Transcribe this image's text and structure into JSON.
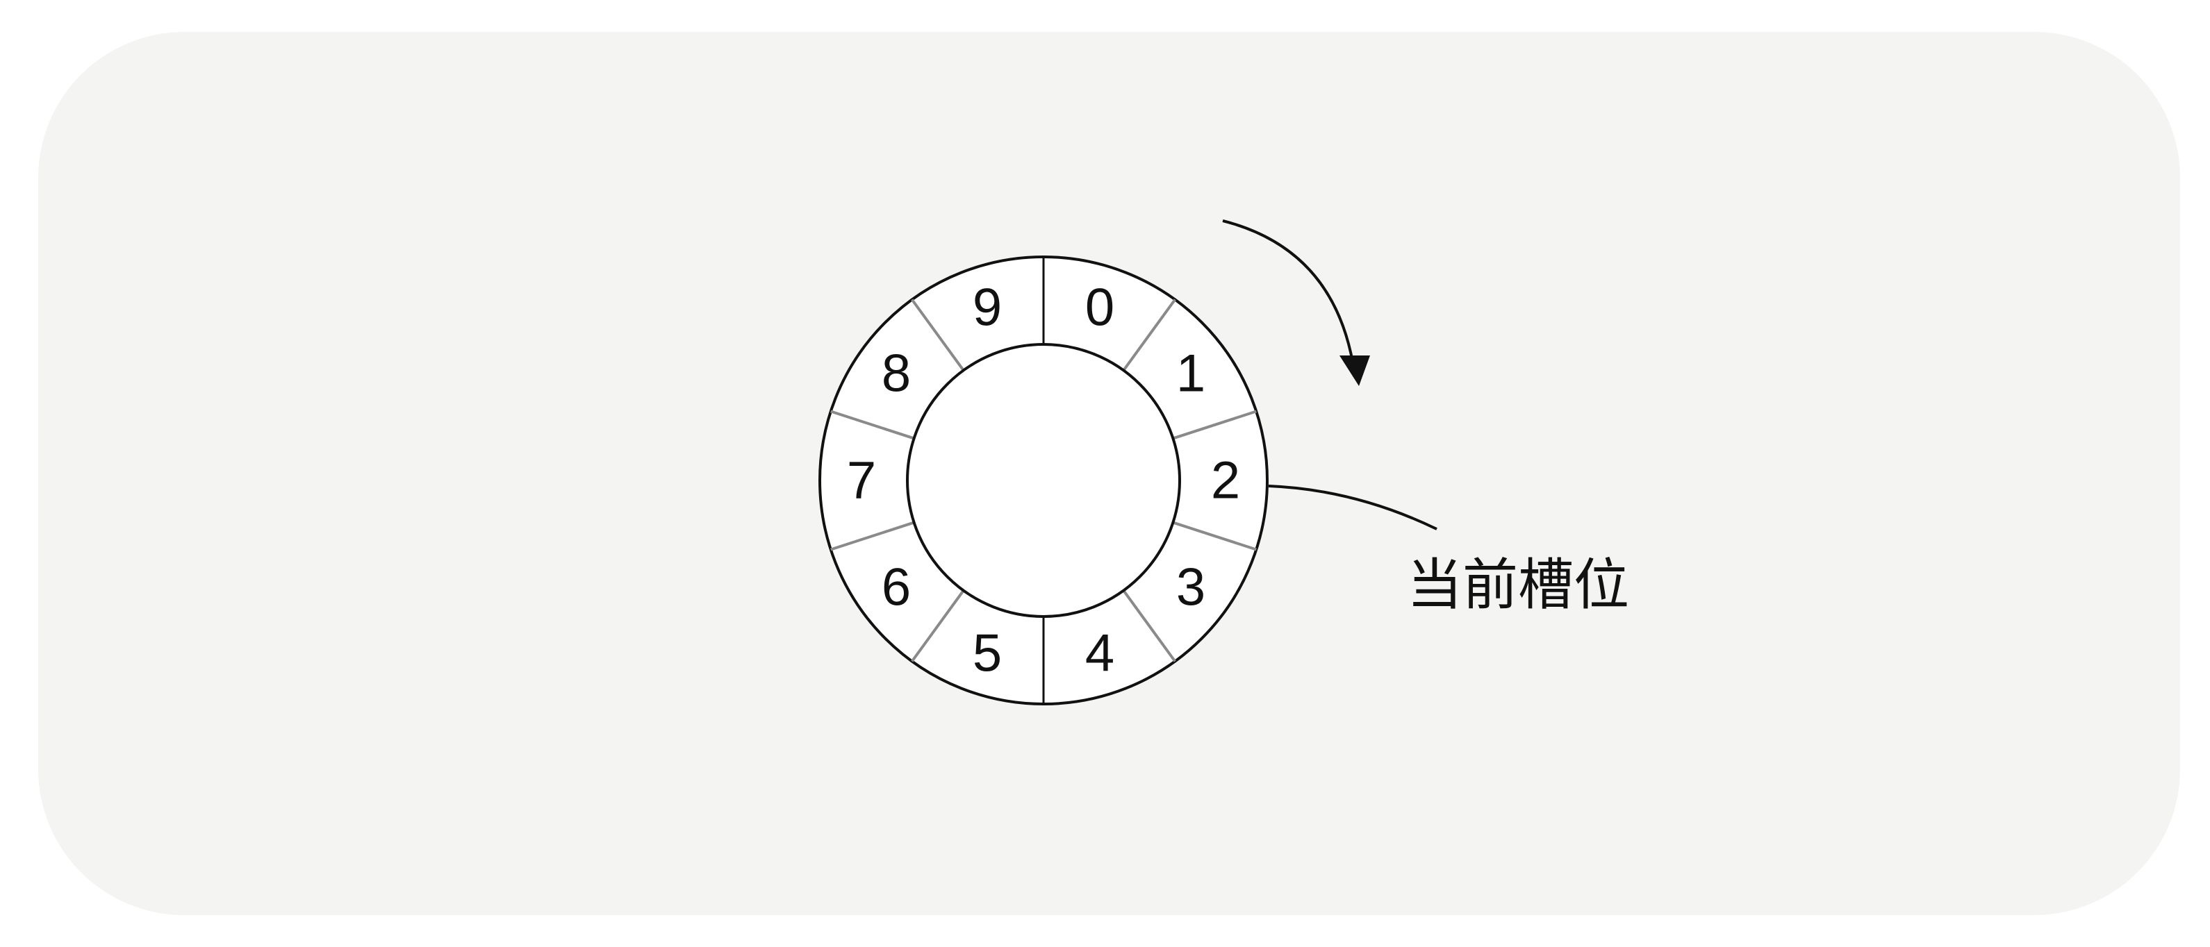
{
  "slots": [
    {
      "label": "0"
    },
    {
      "label": "1"
    },
    {
      "label": "2"
    },
    {
      "label": "3"
    },
    {
      "label": "4"
    },
    {
      "label": "5"
    },
    {
      "label": "6"
    },
    {
      "label": "7"
    },
    {
      "label": "8"
    },
    {
      "label": "9"
    }
  ],
  "current_slot": {
    "label": "当前槽位",
    "slot_index": 2
  },
  "rotation": "clockwise",
  "colors": {
    "background": "#f4f4f3",
    "ring_fill": "#ffffff",
    "stroke": "#111111",
    "divider": "#8a8a8a"
  }
}
